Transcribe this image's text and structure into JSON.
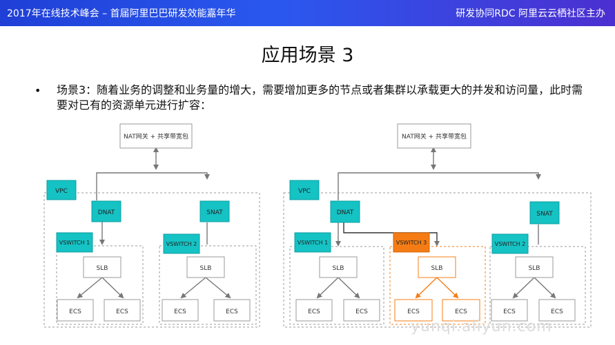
{
  "header": {
    "left_text": "2017年在线技术峰会 – 首届阿里巴巴研发效能嘉年华",
    "right_text": "研发协同RDC 阿里云云栖社区主办"
  },
  "slide": {
    "title": "应用场景 3",
    "bullet": "•",
    "text": "场景3：随着业务的调整和业务量的增大，需要增加更多的节点或者集群以承载更大的并发和访问量，此时需要对已有的资源单元进行扩容："
  },
  "diagram_left": {
    "nat_label": "NAT网关 + 共享带宽包",
    "vpc_label": "VPC",
    "dnat_label": "DNAT",
    "snat_label": "SNAT",
    "vswitch1_label": "VSWITCH 1",
    "vswitch2_label": "VSWITCH 2",
    "slb_label": "SLB",
    "ecs_label": "ECS"
  },
  "diagram_right": {
    "nat_label": "NAT网关 + 共享带宽包",
    "vpc_label": "VPC",
    "dnat_label": "DNAT",
    "snat_label": "SNAT",
    "vswitch1_label": "VSWITCH 1",
    "vswitch2_label": "VSWITCH 2",
    "vswitch3_label": "VSWITCH 3",
    "slb_label": "SLB",
    "ecs_label": "ECS"
  },
  "watermark": "yunqi.aliyun.com",
  "colors": {
    "teal": "#15c2c4",
    "orange": "#f57c14",
    "header_blue": "#2a58ee"
  }
}
